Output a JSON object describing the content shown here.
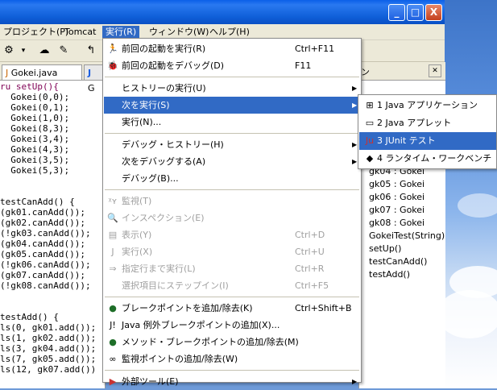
{
  "menubar": {
    "items": [
      "プロジェクト(P)",
      "Tomcat",
      "実行(R)",
      "ウィンドウ(W)",
      "ヘルプ(H)"
    ]
  },
  "window_buttons": {
    "minimize": "_",
    "maximize": "□",
    "close": "X"
  },
  "editor": {
    "tabs": [
      "Gokei.java",
      "G"
    ],
    "code_lines": [
      "ru setUp(){",
      "  Gokei(0,0);",
      "  Gokei(0,1);",
      "  Gokei(1,0);",
      "  Gokei(8,3);",
      "  Gokei(3,4);",
      "  Gokei(4,3);",
      "  Gokei(3,5);",
      "  Gokei(5,3);",
      "",
      "",
      "testCanAdd() {",
      "(gk01.canAdd());",
      "(gk02.canAdd());",
      "(!gk03.canAdd());",
      "(gk04.canAdd());",
      "(gk05.canAdd());",
      "(!gk06.canAdd());",
      "(gk07.canAdd());",
      "(!gk08.canAdd());",
      "",
      "",
      "testAdd() {",
      "ls(0, gk01.add());",
      "ls(1, gk02.add());",
      "ls(3, gk04.add());",
      "ls(7, gk05.add());",
      "ls(12, gk07.add())"
    ]
  },
  "right_pane": {
    "header_fragment": "ン",
    "items": [
      "gk04 : Gokei",
      "gk05 : Gokei",
      "gk06 : Gokei",
      "gk07 : Gokei",
      "gk08 : Gokei",
      "GokeiTest(String)",
      "setUp()",
      "testCanAdd()",
      "testAdd()"
    ]
  },
  "run_menu": {
    "groups": [
      [
        {
          "icon": "run-last-icon",
          "label": "前回の起動を実行(R)",
          "shortcut": "Ctrl+F11"
        },
        {
          "icon": "debug-last-icon",
          "label": "前回の起動をデバッグ(D)",
          "shortcut": "F11"
        }
      ],
      [
        {
          "label": "ヒストリーの実行(U)",
          "submenu": true
        },
        {
          "label": "次を実行(S)",
          "submenu": true,
          "highlighted": true
        },
        {
          "label": "実行(N)..."
        }
      ],
      [
        {
          "label": "デバッグ・ヒストリー(H)",
          "submenu": true
        },
        {
          "label": "次をデバッグする(A)",
          "submenu": true
        },
        {
          "label": "デバッグ(B)..."
        }
      ],
      [
        {
          "icon": "watch-icon",
          "label": "監視(T)",
          "disabled": true
        },
        {
          "icon": "inspect-icon",
          "label": "インスペクション(E)",
          "disabled": true
        },
        {
          "icon": "display-icon",
          "label": "表示(Y)",
          "shortcut": "Ctrl+D",
          "disabled": true
        },
        {
          "icon": "execute-icon",
          "label": "実行(X)",
          "shortcut": "Ctrl+U",
          "disabled": true
        },
        {
          "icon": "run-to-line-icon",
          "label": "指定行まで実行(L)",
          "shortcut": "Ctrl+R",
          "disabled": true
        },
        {
          "label": "選択項目にステップイン(I)",
          "shortcut": "Ctrl+F5",
          "disabled": true
        }
      ],
      [
        {
          "icon": "breakpoint-icon",
          "label": "ブレークポイントを追加/除去(K)",
          "shortcut": "Ctrl+Shift+B"
        },
        {
          "icon": "exception-breakpoint-icon",
          "label": "Java 例外ブレークポイントの追加(X)..."
        },
        {
          "icon": "method-breakpoint-icon",
          "label": "メソッド・ブレークポイントの追加/除去(M)"
        },
        {
          "icon": "watchpoint-icon",
          "label": "監視ポイントの追加/除去(W)"
        }
      ],
      [
        {
          "icon": "external-tools-icon",
          "label": "外部ツール(E)",
          "submenu": true
        }
      ]
    ]
  },
  "run_as_submenu": {
    "items": [
      {
        "icon": "java-app-icon",
        "label": "1 Java アプリケーション"
      },
      {
        "icon": "java-applet-icon",
        "label": "2 Java アプレット"
      },
      {
        "icon": "junit-icon",
        "label": "3 JUnit テスト",
        "highlighted": true
      },
      {
        "icon": "runtime-workbench-icon",
        "label": "4 ランタイム・ワークベンチ"
      }
    ]
  },
  "colors": {
    "highlight": "#316ac5",
    "titlebar": "#0a5fe8",
    "menu_bg": "#ece9d8"
  }
}
